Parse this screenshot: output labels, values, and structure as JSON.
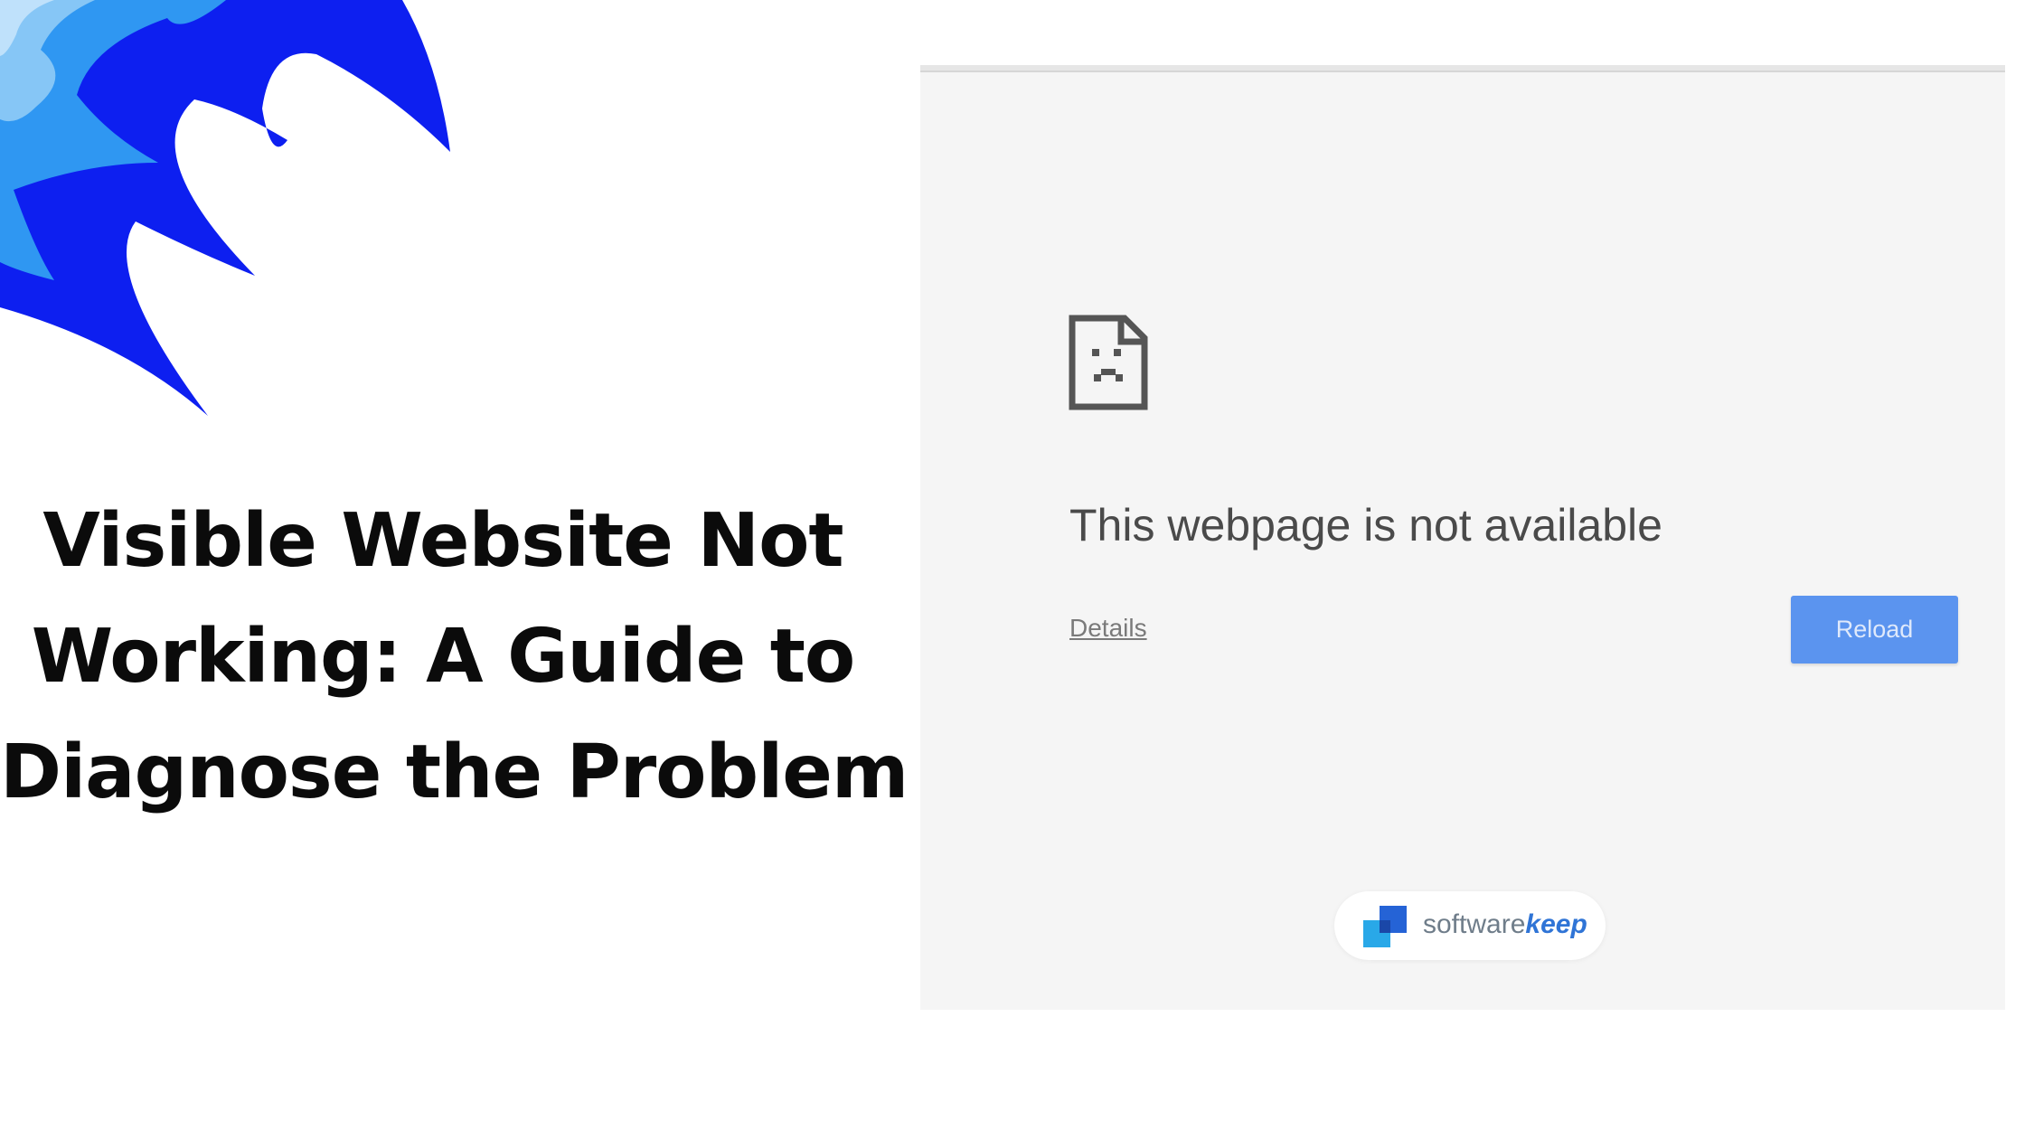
{
  "headline": {
    "line1": "Visible Website Not",
    "line2": "Working: A Guide to",
    "line3": "Diagnose the Problem"
  },
  "browser": {
    "icon": "sad-page-icon",
    "error_title": "This webpage is not available",
    "details_label": "Details",
    "reload_label": "Reload"
  },
  "brand": {
    "icon": "softwarekeep-logo",
    "name_light": "software",
    "name_bold": "keep"
  },
  "colors": {
    "reload_button": "#5b94ef",
    "brand_blue": "#2f74d6",
    "art_dark_blue": "#0d1ff0",
    "art_light_blue": "#2f97f2"
  }
}
